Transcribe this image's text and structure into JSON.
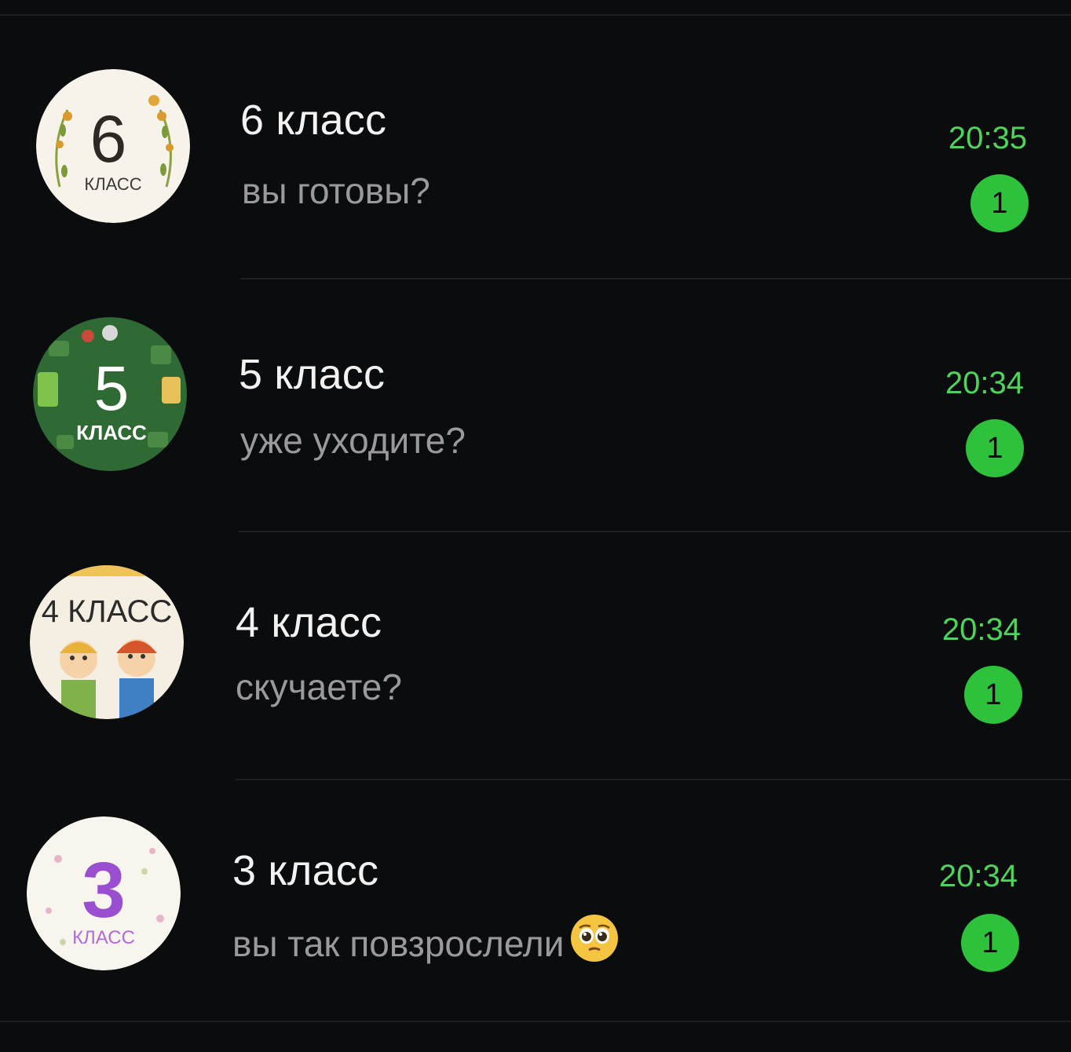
{
  "colors": {
    "background": "#0b0c0e",
    "title": "#f2f2f2",
    "preview": "#9a9a9e",
    "time": "#4fd35a",
    "badge": "#2ec23c"
  },
  "chats": [
    {
      "avatar_text_big": "6",
      "avatar_text_small": "КЛАСС",
      "title": "6 класс",
      "preview": "вы готовы?",
      "time": "20:35",
      "unread": "1"
    },
    {
      "avatar_text_big": "5",
      "avatar_text_small": "КЛАСС",
      "title": "5 класс",
      "preview": "уже уходите?",
      "time": "20:34",
      "unread": "1"
    },
    {
      "avatar_text_big": "4 КЛАСС",
      "title": "4 класс",
      "preview": "скучаете?",
      "time": "20:34",
      "unread": "1"
    },
    {
      "avatar_text_big": "3",
      "avatar_text_small": "КЛАСС",
      "title": "3 класс",
      "preview": "вы так повзрослели",
      "preview_emoji": "pleading-face-emoji",
      "time": "20:34",
      "unread": "1"
    }
  ]
}
